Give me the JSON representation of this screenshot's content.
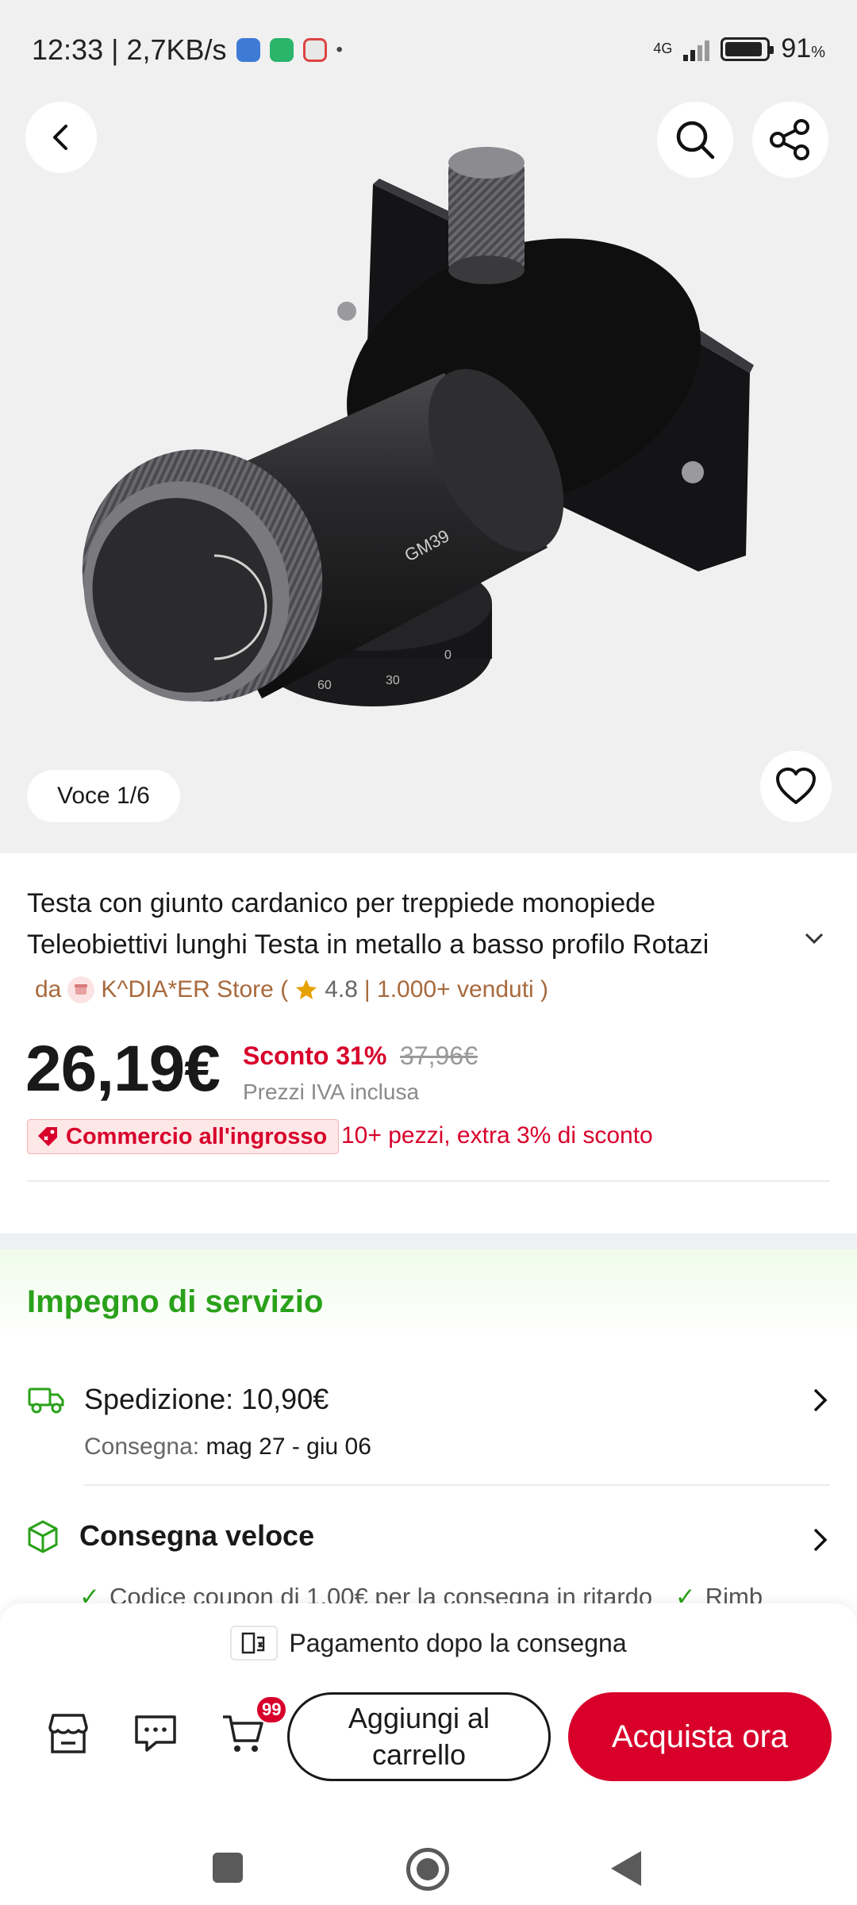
{
  "status_bar": {
    "time_speed": "12:33 | 2,7KB/s",
    "network": "4G",
    "battery": "91",
    "battery_unit": "%",
    "battery_level": 0.91
  },
  "gallery": {
    "counter": "Voce 1/6",
    "engraving": "GM39",
    "scale_labels": [
      "60",
      "30",
      "0"
    ]
  },
  "product": {
    "title_line_1": "Testa con giunto cardanico per treppiede monopiede",
    "title_line_2": "Teleobiettivi lunghi Testa in metallo a basso profilo Rotazi",
    "store_prefix": "da",
    "store_name": "K^DIA*ER Store (",
    "rating": "4.8",
    "sold": "| 1.000+ venduti )",
    "price": "26,19€",
    "discount": "Sconto 31%",
    "old_price": "37,96€",
    "vat_note": "Prezzi IVA inclusa",
    "wholesale_badge": "Commercio all'ingrosso",
    "wholesale_offer": "10+ pezzi, extra 3% di sconto"
  },
  "service": {
    "title": "Impegno di servizio",
    "shipping": "Spedizione: 10,90€",
    "delivery_label": "Consegna:",
    "delivery_dates": "mag 27 - giu 06",
    "fast_delivery": "Consegna veloce",
    "coupon_1": "Codice coupon di 1,00€ per la consegna in ritardo",
    "coupon_2": "Rimb"
  },
  "bottom": {
    "pay_later": "Pagamento dopo la consegna",
    "cart_count": "99",
    "add_to_cart": "Aggiungi al carrello",
    "buy_now": "Acquista ora"
  },
  "colors": {
    "accent_red": "#d8002b",
    "service_green": "#2aa11a",
    "store_brown": "#a86a3d"
  }
}
